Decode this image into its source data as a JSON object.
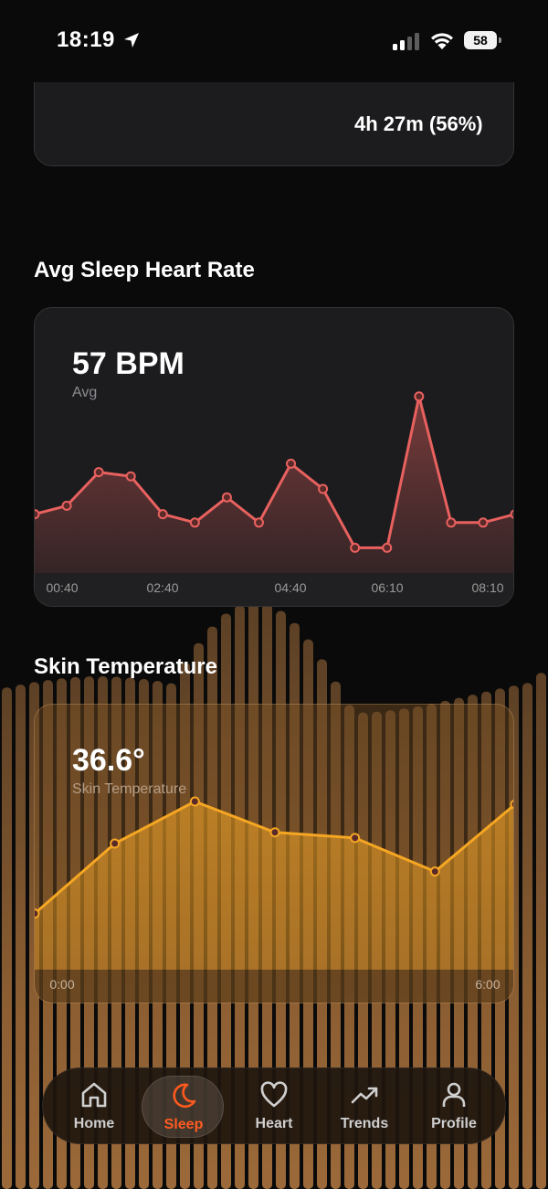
{
  "status_bar": {
    "time": "18:19",
    "battery": "58",
    "icons": [
      "location-arrow-icon",
      "cellular-signal-icon",
      "wifi-icon",
      "battery-icon"
    ]
  },
  "sleep_stages": {
    "value_text": "4h 27m (56%)",
    "ring_colors": [
      "#4cd97b",
      "#f5b41a"
    ]
  },
  "heart_rate": {
    "title": "Avg Sleep Heart Rate",
    "value": "57 BPM",
    "label": "Avg",
    "color": "#e8615f",
    "chart_data": {
      "type": "area",
      "x_ticks": [
        "00:40",
        "02:40",
        "04:40",
        "06:10",
        "08:10"
      ],
      "values": [
        57,
        58,
        62,
        61.5,
        57,
        56,
        59,
        56,
        63,
        60,
        53,
        53,
        71,
        56,
        56,
        57
      ]
    }
  },
  "skin_temp": {
    "title": "Skin Temperature",
    "value": "36.6°",
    "label": "Skin Temperature",
    "color": "#f5a623",
    "chart_data": {
      "type": "area",
      "x_ticks": [
        "0:00",
        "6:00"
      ],
      "values": [
        36.2,
        36.45,
        36.6,
        36.49,
        36.47,
        36.35,
        36.59
      ]
    }
  },
  "tab_bar": {
    "active": "Sleep",
    "tabs": [
      {
        "label": "Home",
        "icon": "home-icon"
      },
      {
        "label": "Sleep",
        "icon": "moon-icon"
      },
      {
        "label": "Heart",
        "icon": "heart-icon"
      },
      {
        "label": "Trends",
        "icon": "trend-up-icon"
      },
      {
        "label": "Profile",
        "icon": "profile-icon"
      }
    ]
  }
}
